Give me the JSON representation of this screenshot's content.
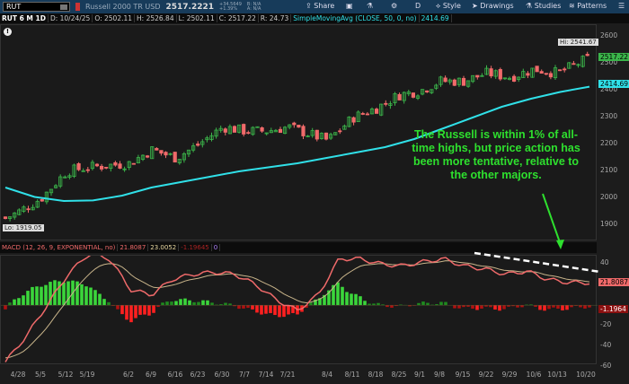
{
  "toolbar": {
    "symbol": "RUT",
    "name": "Russell 2000 TR USD",
    "last": "2517.2221",
    "change": "+34.5649",
    "change_pct": "+1.39%",
    "bid": "B: N/A",
    "ask": "A: N/A",
    "share": "Share",
    "period": "D",
    "style": "Style",
    "drawings": "Drawings",
    "studies": "Studies",
    "patterns": "Patterns"
  },
  "header": {
    "chart": "RUT 6 M 1D",
    "date": "D: 10/24/25",
    "open": "O: 2502.11",
    "high": "H: 2526.84",
    "low": "L: 2502.11",
    "close": "C: 2517.22",
    "range": "R: 24.73",
    "sma": "SimpleMovingAvg (CLOSE, 50, 0, no)",
    "sma_val": "2414.69"
  },
  "macd_header": {
    "label": "MACD (12, 26, 9, EXPONENTIAL, no)",
    "value": "21.8087",
    "avg": "23.0052",
    "diff": "-1.19645",
    "zero": "0"
  },
  "annotation": "The Russell is within 1% of all-time highs, but price action has been more tentative, relative to the other majors.",
  "colors": {
    "up": "#3bb54a",
    "down": "#f06a6a",
    "sma": "#30e0e8",
    "macd": "#f06a6a",
    "signal": "#c8b48a",
    "note": "#2ee02e"
  },
  "chart_data": {
    "type": "candlestick",
    "price_axis": {
      "ticks": [
        "2600",
        "2500",
        "2400",
        "2300",
        "2200",
        "2100",
        "2000",
        "1900"
      ],
      "range": [
        1880,
        2640
      ]
    },
    "macd_axis": {
      "ticks": [
        "40",
        "20",
        "-20",
        "-40",
        "-60"
      ],
      "range": [
        -62,
        52
      ]
    },
    "x_labels": [
      "4/28",
      "5/5",
      "5/12",
      "5/19",
      "6/2",
      "6/9",
      "6/16",
      "6/23",
      "6/30",
      "7/7",
      "7/14",
      "7/21",
      "8/4",
      "8/11",
      "8/18",
      "8/25",
      "9/1",
      "9/8",
      "9/15",
      "9/22",
      "9/29",
      "10/6",
      "10/13",
      "10/20"
    ],
    "weekly_close": [
      1950,
      2000,
      2100,
      2115,
      2130,
      2180,
      2150,
      2200,
      2265,
      2250,
      2250,
      2265,
      2215,
      2300,
      2335,
      2385,
      2400,
      2435,
      2435,
      2465,
      2450,
      2480,
      2465,
      2517
    ],
    "sma50": [
      2040,
      2005,
      1990,
      1992,
      2010,
      2040,
      2060,
      2080,
      2100,
      2115,
      2130,
      2150,
      2170,
      2190,
      2220,
      2260,
      2300,
      2340,
      2370,
      2395,
      2414.69
    ],
    "macd": [
      -55,
      -30,
      0,
      30,
      50,
      45,
      15,
      10,
      25,
      30,
      32,
      30,
      20,
      5,
      -5,
      10,
      45,
      45,
      40,
      38,
      42,
      45,
      38,
      35,
      30,
      33,
      25,
      22,
      21.81
    ],
    "high": "Hi: 2541.67",
    "low": "Lo: 1919.05",
    "last_tag": "2517.22",
    "sma_tag": "2414.69",
    "macd_tag": "21.8087",
    "hist_tag": "-1.1964"
  }
}
